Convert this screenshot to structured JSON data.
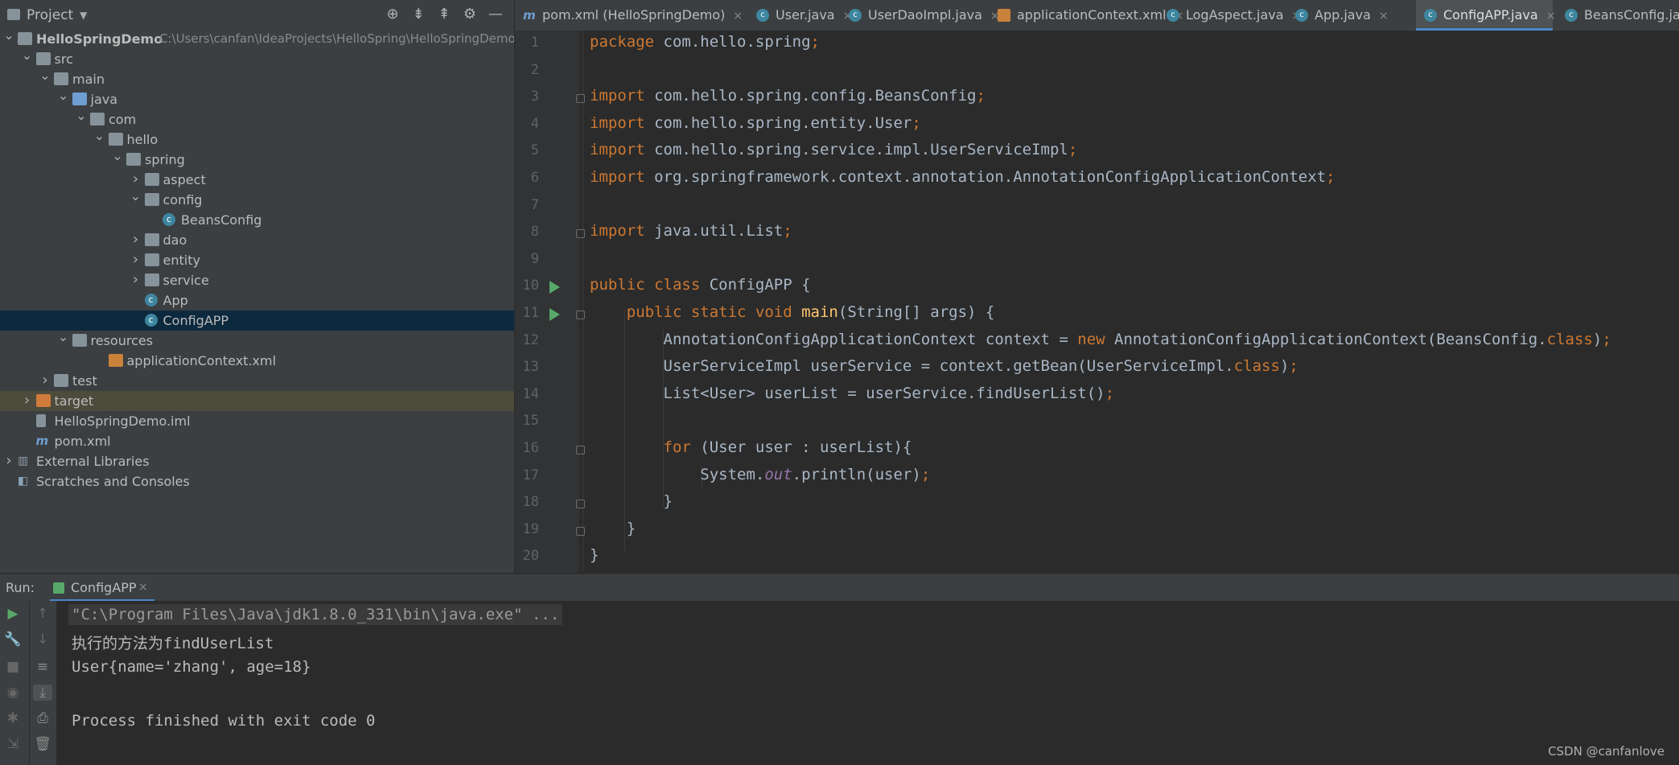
{
  "project_panel": {
    "title": "Project",
    "tree": [
      {
        "label": "HelloSpringDemo",
        "path": "C:\\Users\\canfan\\IdeaProjects\\HelloSpring\\HelloSpringDemo",
        "depth": 0,
        "expanded": true,
        "icon": "module-folder-icon"
      },
      {
        "label": "src",
        "depth": 1,
        "expanded": true,
        "icon": "folder-icon"
      },
      {
        "label": "main",
        "depth": 2,
        "expanded": true,
        "icon": "folder-icon"
      },
      {
        "label": "java",
        "depth": 3,
        "expanded": true,
        "icon": "source-folder-icon"
      },
      {
        "label": "com",
        "depth": 4,
        "expanded": true,
        "icon": "package-icon"
      },
      {
        "label": "hello",
        "depth": 5,
        "expanded": true,
        "icon": "package-icon"
      },
      {
        "label": "spring",
        "depth": 6,
        "expanded": true,
        "icon": "package-icon"
      },
      {
        "label": "aspect",
        "depth": 7,
        "expanded": false,
        "icon": "package-icon"
      },
      {
        "label": "config",
        "depth": 7,
        "expanded": true,
        "icon": "package-icon"
      },
      {
        "label": "BeansConfig",
        "depth": 8,
        "icon": "class-icon"
      },
      {
        "label": "dao",
        "depth": 7,
        "expanded": false,
        "icon": "package-icon"
      },
      {
        "label": "entity",
        "depth": 7,
        "expanded": false,
        "icon": "package-icon"
      },
      {
        "label": "service",
        "depth": 7,
        "expanded": false,
        "icon": "package-icon"
      },
      {
        "label": "App",
        "depth": 7,
        "icon": "runnable-class-icon"
      },
      {
        "label": "ConfigAPP",
        "depth": 7,
        "icon": "runnable-class-icon",
        "selected": true
      },
      {
        "label": "resources",
        "depth": 3,
        "expanded": true,
        "icon": "resources-folder-icon"
      },
      {
        "label": "applicationContext.xml",
        "depth": 5,
        "icon": "xml-file-icon"
      },
      {
        "label": "test",
        "depth": 2,
        "expanded": false,
        "icon": "folder-icon"
      },
      {
        "label": "target",
        "depth": 1,
        "expanded": false,
        "icon": "excluded-folder-icon",
        "excluded": true
      },
      {
        "label": "HelloSpringDemo.iml",
        "depth": 1,
        "icon": "iml-file-icon"
      },
      {
        "label": "pom.xml",
        "depth": 1,
        "icon": "maven-icon"
      },
      {
        "label": "External Libraries",
        "depth": 0,
        "expanded": false,
        "icon": "libraries-icon"
      },
      {
        "label": "Scratches and Consoles",
        "depth": 0,
        "icon": "scratches-icon"
      }
    ]
  },
  "tabs": [
    {
      "label": "pom.xml (HelloSpringDemo)",
      "icon": "maven-icon"
    },
    {
      "label": "User.java",
      "icon": "class-icon"
    },
    {
      "label": "UserDaoImpl.java",
      "icon": "class-icon"
    },
    {
      "label": "applicationContext.xml",
      "icon": "xml-file-icon"
    },
    {
      "label": "LogAspect.java",
      "icon": "class-icon"
    },
    {
      "label": "App.java",
      "icon": "runnable-class-icon"
    },
    {
      "label": "ConfigAPP.java",
      "icon": "runnable-class-icon",
      "active": true
    },
    {
      "label": "BeansConfig.java",
      "icon": "class-icon"
    }
  ],
  "editor": {
    "line_numbers": [
      "1",
      "2",
      "3",
      "4",
      "5",
      "6",
      "7",
      "8",
      "9",
      "10",
      "11",
      "12",
      "13",
      "14",
      "15",
      "16",
      "17",
      "18",
      "19",
      "20"
    ],
    "lines": [
      [
        [
          "kw",
          "package "
        ],
        [
          "t",
          "com.hello.spring"
        ],
        [
          "kw",
          ";"
        ]
      ],
      [],
      [
        [
          "kw",
          "import "
        ],
        [
          "t",
          "com.hello.spring.config.BeansConfig"
        ],
        [
          "kw",
          ";"
        ]
      ],
      [
        [
          "kw",
          "import "
        ],
        [
          "t",
          "com.hello.spring.entity.User"
        ],
        [
          "kw",
          ";"
        ]
      ],
      [
        [
          "kw",
          "import "
        ],
        [
          "t",
          "com.hello.spring.service.impl.UserServiceImpl"
        ],
        [
          "kw",
          ";"
        ]
      ],
      [
        [
          "kw",
          "import "
        ],
        [
          "t",
          "org.springframework.context.annotation.AnnotationConfigApplicationContext"
        ],
        [
          "kw",
          ";"
        ]
      ],
      [],
      [
        [
          "kw",
          "import "
        ],
        [
          "t",
          "java.util.List"
        ],
        [
          "kw",
          ";"
        ]
      ],
      [],
      [
        [
          "kw",
          "public class "
        ],
        [
          "t",
          "ConfigAPP {"
        ]
      ],
      [
        [
          "t",
          "    "
        ],
        [
          "kw",
          "public static void "
        ],
        [
          "fn",
          "main"
        ],
        [
          "t",
          "(String[] args) {"
        ]
      ],
      [
        [
          "t",
          "        AnnotationConfigApplicationContext context = "
        ],
        [
          "kw",
          "new "
        ],
        [
          "t",
          "AnnotationConfigApplicationContext(BeansConfig."
        ],
        [
          "kw",
          "class"
        ],
        [
          "t",
          ")"
        ],
        [
          "kw",
          ";"
        ]
      ],
      [
        [
          "t",
          "        UserServiceImpl userService = context.getBean(UserServiceImpl."
        ],
        [
          "kw",
          "class"
        ],
        [
          "t",
          ")"
        ],
        [
          "kw",
          ";"
        ]
      ],
      [
        [
          "t",
          "        List<User> userList = userService.findUserList()"
        ],
        [
          "kw",
          ";"
        ]
      ],
      [],
      [
        [
          "t",
          "        "
        ],
        [
          "kw",
          "for "
        ],
        [
          "t",
          "(User user : userList){"
        ]
      ],
      [
        [
          "t",
          "            System."
        ],
        [
          "it",
          "out"
        ],
        [
          "t",
          ".println(user)"
        ],
        [
          "kw",
          ";"
        ]
      ],
      [
        [
          "t",
          "        }"
        ]
      ],
      [
        [
          "t",
          "    }"
        ]
      ],
      [
        [
          "t",
          "}"
        ]
      ]
    ]
  },
  "run_panel": {
    "label": "Run:",
    "tab_label": "ConfigAPP",
    "console_lines": [
      "\"C:\\Program Files\\Java\\jdk1.8.0_331\\bin\\java.exe\" ...",
      "执行的方法为findUserList",
      "User{name='zhang', age=18}",
      "",
      "Process finished with exit code 0"
    ]
  },
  "watermark": "CSDN @canfanlove",
  "colors": {
    "keyword": "#cc7832",
    "method": "#ffc66d",
    "field": "#9876aa",
    "text": "#a9b7c6",
    "selection": "#0d293e",
    "accent": "#4a88c7"
  }
}
